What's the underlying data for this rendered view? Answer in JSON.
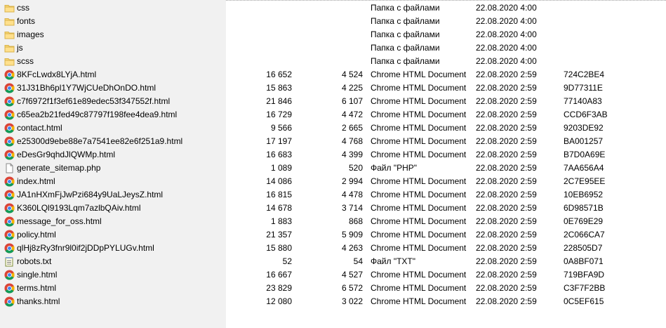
{
  "files": [
    {
      "name": "css",
      "size": "",
      "packed": "",
      "type": "Папка с файлами",
      "modified": "22.08.2020 4:00",
      "crc": "",
      "icon": "folder-icon"
    },
    {
      "name": "fonts",
      "size": "",
      "packed": "",
      "type": "Папка с файлами",
      "modified": "22.08.2020 4:00",
      "crc": "",
      "icon": "folder-icon"
    },
    {
      "name": "images",
      "size": "",
      "packed": "",
      "type": "Папка с файлами",
      "modified": "22.08.2020 4:00",
      "crc": "",
      "icon": "folder-icon"
    },
    {
      "name": "js",
      "size": "",
      "packed": "",
      "type": "Папка с файлами",
      "modified": "22.08.2020 4:00",
      "crc": "",
      "icon": "folder-icon"
    },
    {
      "name": "scss",
      "size": "",
      "packed": "",
      "type": "Папка с файлами",
      "modified": "22.08.2020 4:00",
      "crc": "",
      "icon": "folder-icon"
    },
    {
      "name": "8KFcLwdx8LYjA.html",
      "size": "16 652",
      "packed": "4 524",
      "type": "Chrome HTML Document",
      "modified": "22.08.2020 2:59",
      "crc": "724C2BE4",
      "icon": "chrome-icon"
    },
    {
      "name": "31J31Bh6pl1Y7WjCUeDhOnDO.html",
      "size": "15 863",
      "packed": "4 225",
      "type": "Chrome HTML Document",
      "modified": "22.08.2020 2:59",
      "crc": "9D77311E",
      "icon": "chrome-icon"
    },
    {
      "name": "c7f6972f1f3ef61e89edec53f347552f.html",
      "size": "21 846",
      "packed": "6 107",
      "type": "Chrome HTML Document",
      "modified": "22.08.2020 2:59",
      "crc": "77140A83",
      "icon": "chrome-icon"
    },
    {
      "name": "c65ea2b21fed49c87797f198fee4dea9.html",
      "size": "16 729",
      "packed": "4 472",
      "type": "Chrome HTML Document",
      "modified": "22.08.2020 2:59",
      "crc": "CCD6F3AB",
      "icon": "chrome-icon"
    },
    {
      "name": "contact.html",
      "size": "9 566",
      "packed": "2 665",
      "type": "Chrome HTML Document",
      "modified": "22.08.2020 2:59",
      "crc": "9203DE92",
      "icon": "chrome-icon"
    },
    {
      "name": "e25300d9ebe88e7a7541ee82e6f251a9.html",
      "size": "17 197",
      "packed": "4 768",
      "type": "Chrome HTML Document",
      "modified": "22.08.2020 2:59",
      "crc": "BA001257",
      "icon": "chrome-icon"
    },
    {
      "name": "eDesGr9qhdJlQWMp.html",
      "size": "16 683",
      "packed": "4 399",
      "type": "Chrome HTML Document",
      "modified": "22.08.2020 2:59",
      "crc": "B7D0A69E",
      "icon": "chrome-icon"
    },
    {
      "name": "generate_sitemap.php",
      "size": "1 089",
      "packed": "520",
      "type": "Файл \"PHP\"",
      "modified": "22.08.2020 2:59",
      "crc": "7AA656A4",
      "icon": "file-icon"
    },
    {
      "name": "index.html",
      "size": "14 086",
      "packed": "2 994",
      "type": "Chrome HTML Document",
      "modified": "22.08.2020 2:59",
      "crc": "2C7E95EE",
      "icon": "chrome-icon"
    },
    {
      "name": "JA1nHXmFjJwPzi684y9UaLJeysZ.html",
      "size": "16 815",
      "packed": "4 478",
      "type": "Chrome HTML Document",
      "modified": "22.08.2020 2:59",
      "crc": "10EB6952",
      "icon": "chrome-icon"
    },
    {
      "name": "K360LQl9193Lqm7azlbQAiv.html",
      "size": "14 678",
      "packed": "3 714",
      "type": "Chrome HTML Document",
      "modified": "22.08.2020 2:59",
      "crc": "6D98571B",
      "icon": "chrome-icon"
    },
    {
      "name": "message_for_oss.html",
      "size": "1 883",
      "packed": "868",
      "type": "Chrome HTML Document",
      "modified": "22.08.2020 2:59",
      "crc": "0E769E29",
      "icon": "chrome-icon"
    },
    {
      "name": "policy.html",
      "size": "21 357",
      "packed": "5 909",
      "type": "Chrome HTML Document",
      "modified": "22.08.2020 2:59",
      "crc": "2C066CA7",
      "icon": "chrome-icon"
    },
    {
      "name": "qlHj8zRy3fnr9l0if2jDDpPYLUGv.html",
      "size": "15 880",
      "packed": "4 263",
      "type": "Chrome HTML Document",
      "modified": "22.08.2020 2:59",
      "crc": "228505D7",
      "icon": "chrome-icon"
    },
    {
      "name": "robots.txt",
      "size": "52",
      "packed": "54",
      "type": "Файл \"TXT\"",
      "modified": "22.08.2020 2:59",
      "crc": "0A8BF071",
      "icon": "notepad-icon"
    },
    {
      "name": "single.html",
      "size": "16 667",
      "packed": "4 527",
      "type": "Chrome HTML Document",
      "modified": "22.08.2020 2:59",
      "crc": "719BFA9D",
      "icon": "chrome-icon"
    },
    {
      "name": "terms.html",
      "size": "23 829",
      "packed": "6 572",
      "type": "Chrome HTML Document",
      "modified": "22.08.2020 2:59",
      "crc": "C3F7F2BB",
      "icon": "chrome-icon"
    },
    {
      "name": "thanks.html",
      "size": "12 080",
      "packed": "3 022",
      "type": "Chrome HTML Document",
      "modified": "22.08.2020 2:59",
      "crc": "0C5EF615",
      "icon": "chrome-icon"
    }
  ]
}
